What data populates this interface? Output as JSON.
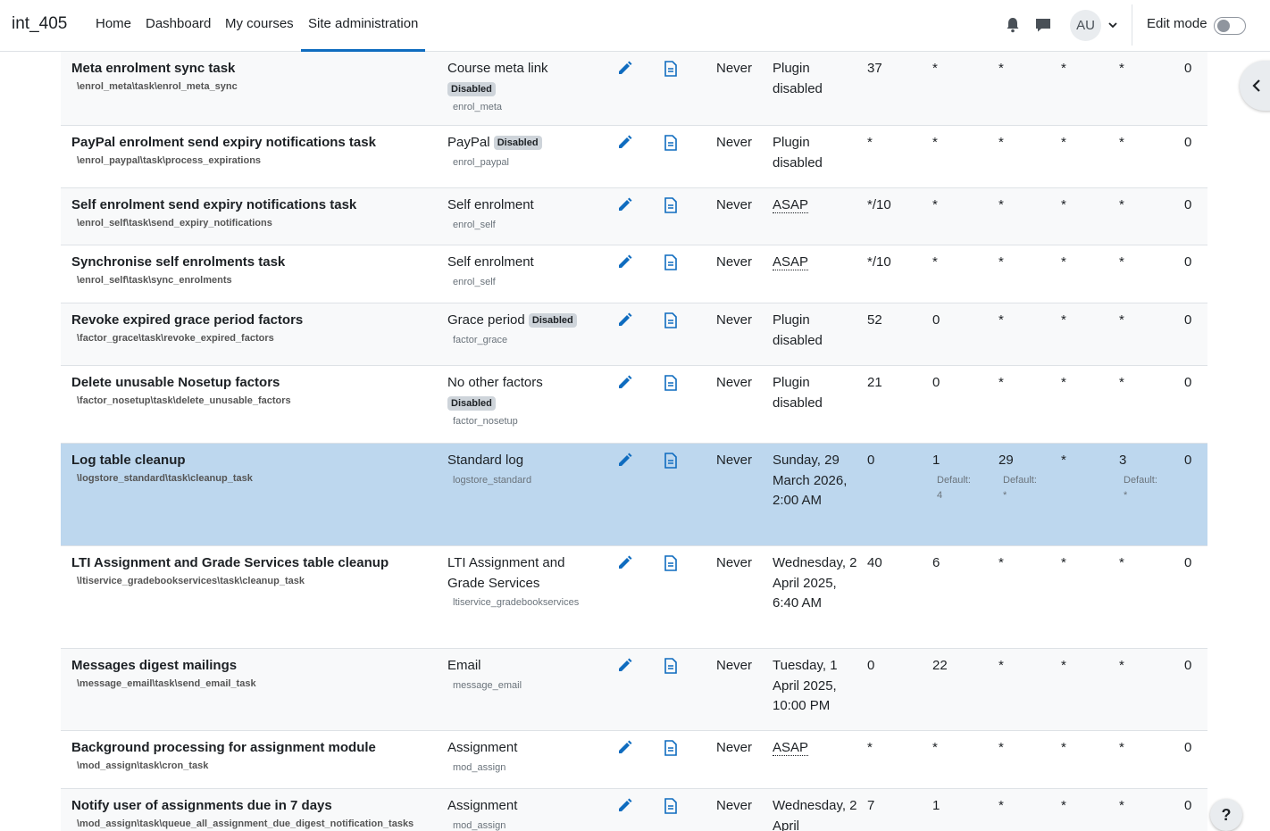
{
  "navbar": {
    "brand": "int_405",
    "links": [
      "Home",
      "Dashboard",
      "My courses",
      "Site administration"
    ],
    "avatar": "AU",
    "edit_mode_label": "Edit mode"
  },
  "icons": {
    "notifications": "bell-icon",
    "messages": "chat-icon",
    "edit": "pencil-icon",
    "log": "document-icon",
    "drawer": "chevron-left-icon"
  },
  "colors": {
    "accent": "#0f6cbf",
    "highlight_row": "#bdd7ee",
    "badge": "#ced4da"
  },
  "help_label": "?",
  "rows": [
    {
      "name": "Meta enrolment sync task",
      "class": "\\enrol_meta\\task\\enrol_meta_sync",
      "component": "Course meta link",
      "badge": "Disabled",
      "comp_sub": "enrol_meta",
      "last": "Never",
      "next": "Plugin disabled",
      "minute": "37",
      "hour": "*",
      "day": "*",
      "month": "*",
      "dow": "*",
      "fail": "0"
    },
    {
      "name": "PayPal enrolment send expiry notifications task",
      "class": "\\enrol_paypal\\task\\process_expirations",
      "component": "PayPal",
      "badge": "Disabled",
      "comp_sub": "enrol_paypal",
      "last": "Never",
      "next": "Plugin disabled",
      "minute": "*",
      "hour": "*",
      "day": "*",
      "month": "*",
      "dow": "*",
      "fail": "0"
    },
    {
      "name": "Self enrolment send expiry notifications task",
      "class": "\\enrol_self\\task\\send_expiry_notifications",
      "component": "Self enrolment",
      "badge": "",
      "comp_sub": "enrol_self",
      "last": "Never",
      "next": "ASAP",
      "minute": "*/10",
      "hour": "*",
      "day": "*",
      "month": "*",
      "dow": "*",
      "fail": "0"
    },
    {
      "name": "Synchronise self enrolments task",
      "class": "\\enrol_self\\task\\sync_enrolments",
      "component": "Self enrolment",
      "badge": "",
      "comp_sub": "enrol_self",
      "last": "Never",
      "next": "ASAP",
      "minute": "*/10",
      "hour": "*",
      "day": "*",
      "month": "*",
      "dow": "*",
      "fail": "0"
    },
    {
      "name": "Revoke expired grace period factors",
      "class": "\\factor_grace\\task\\revoke_expired_factors",
      "component": "Grace period",
      "badge": "Disabled",
      "comp_sub": "factor_grace",
      "last": "Never",
      "next": "Plugin disabled",
      "minute": "52",
      "hour": "0",
      "day": "*",
      "month": "*",
      "dow": "*",
      "fail": "0"
    },
    {
      "name": "Delete unusable Nosetup factors",
      "class": "\\factor_nosetup\\task\\delete_unusable_factors",
      "component": "No other factors",
      "badge": "Disabled",
      "comp_sub": "factor_nosetup",
      "last": "Never",
      "next": "Plugin disabled",
      "minute": "21",
      "hour": "0",
      "day": "*",
      "month": "*",
      "dow": "*",
      "fail": "0"
    },
    {
      "name": "Log table cleanup",
      "class": "\\logstore_standard\\task\\cleanup_task",
      "component": "Standard log",
      "badge": "",
      "comp_sub": "logstore_standard",
      "last": "Never",
      "next": "Sunday, 29 March 2026, 2:00 AM",
      "minute": "0",
      "hour": "1",
      "day": "29",
      "month": "*",
      "dow": "3",
      "fail": "0",
      "default_label": "Default:",
      "hour_default": "4",
      "day_default": "*",
      "dow_default": "*"
    },
    {
      "name": "LTI Assignment and Grade Services table cleanup",
      "class": "\\ltiservice_gradebookservices\\task\\cleanup_task",
      "component": "LTI Assignment and Grade Services",
      "badge": "",
      "comp_sub": "ltiservice_gradebookservices",
      "last": "Never",
      "next": "Wednesday, 2 April 2025, 6:40 AM",
      "minute": "40",
      "hour": "6",
      "day": "*",
      "month": "*",
      "dow": "*",
      "fail": "0"
    },
    {
      "name": "Messages digest mailings",
      "class": "\\message_email\\task\\send_email_task",
      "component": "Email",
      "badge": "",
      "comp_sub": "message_email",
      "last": "Never",
      "next": "Tuesday, 1 April 2025, 10:00 PM",
      "minute": "0",
      "hour": "22",
      "day": "*",
      "month": "*",
      "dow": "*",
      "fail": "0"
    },
    {
      "name": "Background processing for assignment module",
      "class": "\\mod_assign\\task\\cron_task",
      "component": "Assignment",
      "badge": "",
      "comp_sub": "mod_assign",
      "last": "Never",
      "next": "ASAP",
      "minute": "*",
      "hour": "*",
      "day": "*",
      "month": "*",
      "dow": "*",
      "fail": "0"
    },
    {
      "name": "Notify user of assignments due in 7 days",
      "class": "\\mod_assign\\task\\queue_all_assignment_due_digest_notification_tasks",
      "component": "Assignment",
      "badge": "",
      "comp_sub": "mod_assign",
      "last": "Never",
      "next": "Wednesday, 2 April",
      "minute": "7",
      "hour": "1",
      "day": "*",
      "month": "*",
      "dow": "*",
      "fail": "0"
    }
  ]
}
